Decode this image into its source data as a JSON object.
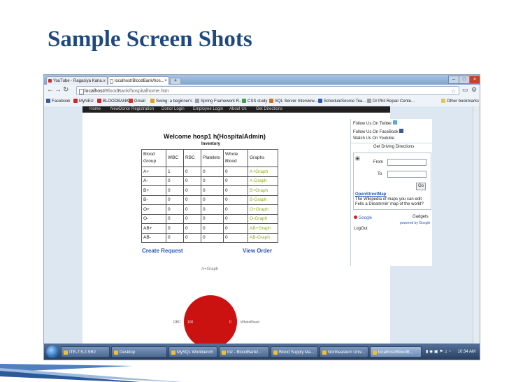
{
  "slide": {
    "title": "Sample Screen Shots"
  },
  "browser": {
    "tabs": [
      {
        "label": "YouTube - Ragasiya Kana...",
        "icon_color": "#d22b2b"
      },
      {
        "label": "localhost/BloodBank/hos...",
        "icon_color": "#ffffff"
      }
    ],
    "address": {
      "host": "localhost",
      "path": "/BloodBank/hospitalhome.htm"
    },
    "bookmarks": [
      {
        "label": "Facebook",
        "color": "#3b5998"
      },
      {
        "label": "MyNEU",
        "color": "#c62828"
      },
      {
        "label": "BLOODBANK",
        "color": "#c62828"
      },
      {
        "label": "Gmail",
        "color": "#d93025"
      },
      {
        "label": "Swing: a beginner's ...",
        "color": "#e0a020"
      },
      {
        "label": "Spring Framework R...",
        "color": "#9e9e9e"
      },
      {
        "label": "CSS study",
        "color": "#3aa34a"
      },
      {
        "label": "SQL Server Interview...",
        "color": "#d07020"
      },
      {
        "label": "ScheduleSource Tea...",
        "color": "#2a58b8"
      },
      {
        "label": "Dr Phil Repair Cente...",
        "color": "#9e9e9e"
      }
    ],
    "other_bookmarks": "Other bookmarks"
  },
  "webpage": {
    "nav": [
      "Home",
      "NewDonor Registration",
      "Donor Login",
      "Employee Login",
      "About Us",
      "Get Directions"
    ],
    "welcome": "Welcome hosp1 h(HospitalAdmin)",
    "inventory_caption": "Inventory",
    "table": {
      "headers": [
        "Blood Group",
        "WBC",
        "RBC",
        "Platelets",
        "Whole Blood",
        "Graphs"
      ],
      "rows": [
        [
          "A+",
          "1",
          "0",
          "0",
          "0",
          "A+Graph"
        ],
        [
          "A-",
          "0",
          "0",
          "0",
          "0",
          "A-Graph"
        ],
        [
          "B+",
          "0",
          "0",
          "0",
          "0",
          "B+Graph"
        ],
        [
          "B-",
          "0",
          "0",
          "0",
          "0",
          "B-Graph"
        ],
        [
          "O+",
          "0",
          "0",
          "0",
          "0",
          "O+Graph"
        ],
        [
          "O-",
          "0",
          "0",
          "0",
          "0",
          "O-Graph"
        ],
        [
          "AB+",
          "0",
          "0",
          "0",
          "0",
          "AB+Graph"
        ],
        [
          "AB-",
          "0",
          "0",
          "0",
          "0",
          "AB-Graph"
        ]
      ]
    },
    "create_request": "Create Request",
    "view_order": "View Order",
    "pie": {
      "title": "A+Graph",
      "label_left": "RBC",
      "value_left": "100",
      "value_right": "0",
      "label_right": "WholeBlood",
      "color": "#cc1111"
    },
    "side": {
      "follow_twitter": "Follow Us On Twitter",
      "follow_facebook": "Follow Us On FaceBook",
      "watch_youtube": "Watch Us On Youtube",
      "get_directions": "Get Driving Directions",
      "from_label": "From",
      "to_label": "To",
      "go_label": "Go",
      "map_title": "OpenStreetMap",
      "map_text": "The Wikipedia of maps you can edit",
      "map_text2": "Fells a Dreamrnin' map of the world?",
      "gadgets": "Gadgets",
      "powered": "powered by Google",
      "google_label": "Google",
      "logout": "LogOut"
    }
  },
  "taskbar": {
    "items": [
      "ITE-7.5.2.SR2",
      "Desktop",
      "MySQL Workbench",
      "Inz - BloodBank/...",
      "Blood Supply Ma...",
      "Northeastern Univ...",
      "localhost/BloodB..."
    ],
    "clock": "10:34 AM"
  }
}
